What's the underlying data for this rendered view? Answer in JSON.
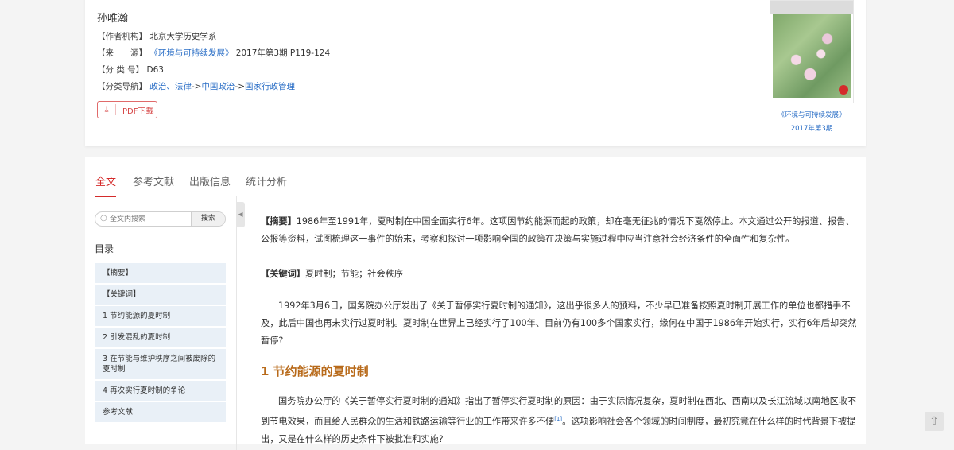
{
  "author": "孙唯瀚",
  "meta": {
    "affiliation_label": "【作者机构】",
    "affiliation": "北京大学历史学系",
    "source_label": "【来　　源】",
    "source_journal": "《环境与可持续发展》",
    "source_issue": "2017年第3期 P119-124",
    "class_label": "【分 类 号】",
    "class_no": "D63",
    "nav_label": "【分类导航】",
    "nav_1": "政治、法律",
    "nav_sep1": "->",
    "nav_2": "中国政治",
    "nav_sep2": "->",
    "nav_3": "国家行政管理"
  },
  "pdf_button": {
    "icon": "download-icon",
    "label": "PDF下载"
  },
  "cover": {
    "caption_1": "《环境与可持续发展》",
    "caption_2": "2017年第3期"
  },
  "tabs": [
    {
      "label": "全文",
      "active": true
    },
    {
      "label": "参考文献",
      "active": false
    },
    {
      "label": "出版信息",
      "active": false
    },
    {
      "label": "统计分析",
      "active": false
    }
  ],
  "search": {
    "placeholder": "全文内搜索",
    "button": "搜索"
  },
  "toc": {
    "title": "目录",
    "items": [
      "【摘要】",
      "【关键词】",
      "1 节约能源的夏时制",
      "2 引发混乱的夏时制",
      "3 在节能与维护秩序之间被废除的夏时制",
      "4 再次实行夏时制的争论",
      "参考文献"
    ]
  },
  "content": {
    "abstract_label": "【摘要】",
    "abstract": "1986年至1991年，夏时制在中国全面实行6年。这项因节约能源而起的政策，却在毫无征兆的情况下戛然停止。本文通过公开的报道、报告、公报等资料，试图梳理这一事件的始末，考察和探讨一项影响全国的政策在决策与实施过程中应当注意社会经济条件的全面性和复杂性。",
    "keywords_label": "【关键词】",
    "keywords": "夏时制；节能；社会秩序",
    "para1": "1992年3月6日，国务院办公厅发出了《关于暂停实行夏时制的通知》，这出乎很多人的预料，不少早已准备按照夏时制开展工作的单位也都措手不及，此后中国也再未实行过夏时制。夏时制在世界上已经实行了100年、目前仍有100多个国家实行，缘何在中国于1986年开始实行，实行6年后却突然暂停?",
    "section1_title": "1 节约能源的夏时制",
    "para2_a": "国务院办公厅的《关于暂停实行夏时制的通知》指出了暂停实行夏时制的原因：由于实际情况复杂，夏时制在西北、西南以及长江流域以南地区收不到节电效果，而且给人民群众的生活和铁路运输等行业的工作带来许多不便",
    "para2_ref": "[1]",
    "para2_b": "。这项影响社会各个领域的时间制度，最初究竟在什么样的时代背景下被提出，又是在什么样的历史条件下被批准和实施?"
  },
  "back_to_top": "arrow-up-icon"
}
